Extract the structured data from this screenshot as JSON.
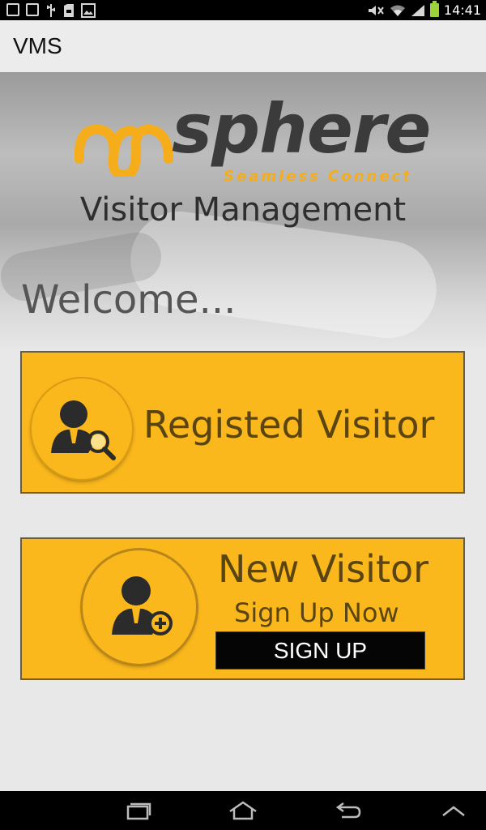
{
  "status_bar": {
    "time": "14:41",
    "icons": [
      "notification-icon",
      "notification-icon",
      "usb-icon",
      "sd-card-icon",
      "image-icon",
      "mute-icon",
      "wifi-icon",
      "signal-icon",
      "battery-icon"
    ]
  },
  "action_bar": {
    "title": "VMS"
  },
  "logo": {
    "wordmark": "sphere",
    "tagline": "Seamless Connect",
    "brand_color": "#f5ad1b"
  },
  "hero": {
    "subtitle": "Visitor Management"
  },
  "welcome": "Welcome...",
  "registered_card": {
    "label": "Registed Visitor",
    "icon": "user-search-icon"
  },
  "new_card": {
    "label": "New Visitor",
    "sub_label": "Sign Up Now",
    "button_label": "SIGN UP",
    "icon": "user-add-icon"
  },
  "nav_bar": {
    "buttons": [
      "recent-apps-icon",
      "home-icon",
      "back-icon",
      "menu-up-icon"
    ]
  },
  "colors": {
    "card": "#fbb81c",
    "card_text": "#5a4512",
    "accent": "#f5ad1b"
  }
}
